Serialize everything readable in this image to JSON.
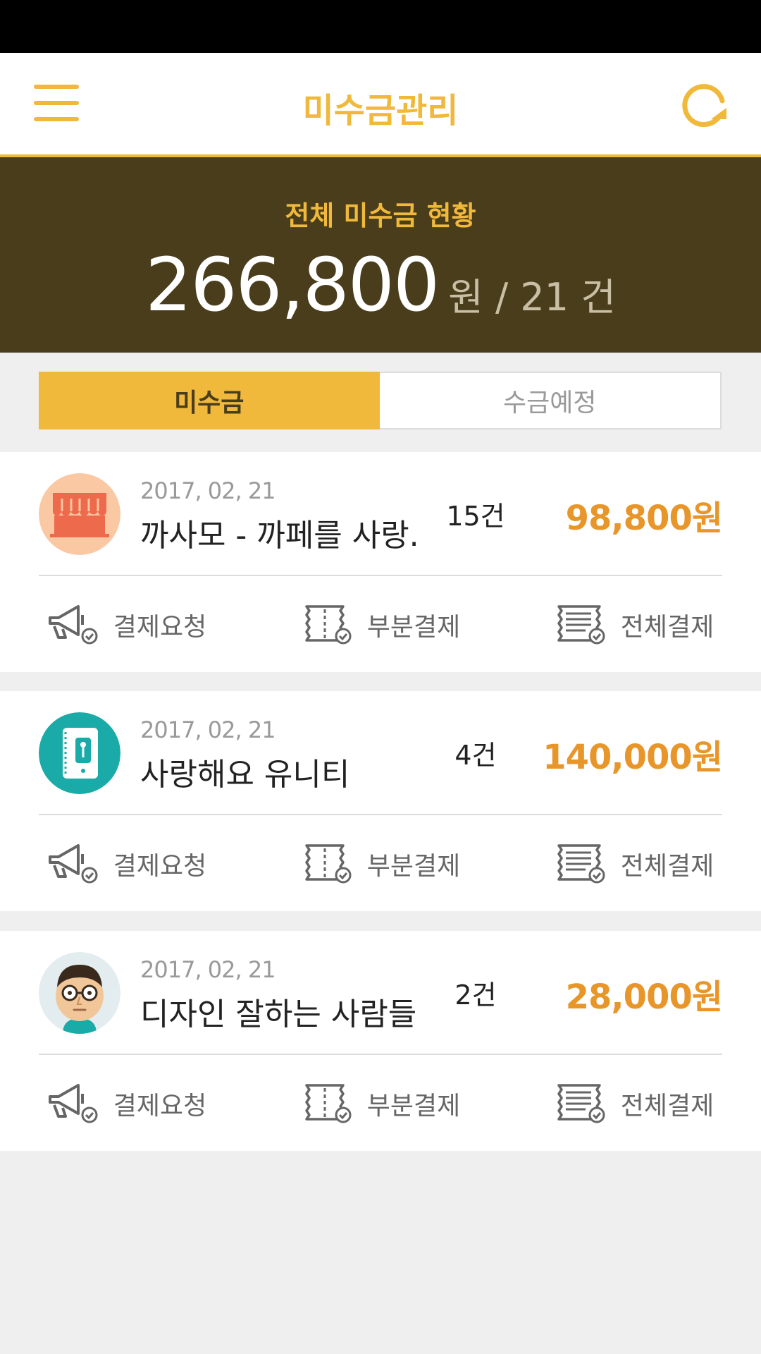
{
  "header": {
    "title": "미수금관리",
    "menu_icon": "hamburger-menu-icon",
    "refresh_icon": "refresh-icon",
    "accent": "#f0b93b"
  },
  "summary": {
    "label": "전체 미수금 현황",
    "amount": "266,800",
    "unit": "원 / 21 건",
    "bg": "#4a3d1c"
  },
  "tabs": [
    {
      "label": "미수금",
      "active": true
    },
    {
      "label": "수금예정",
      "active": false
    }
  ],
  "items": [
    {
      "avatar_icon": "store-awning-icon",
      "date": "2017, 02, 21",
      "name": "까사모 - 까페를 사랑...",
      "count": "15건",
      "amount": "98,800원"
    },
    {
      "avatar_icon": "zipper-notebook-icon",
      "date": "2017, 02, 21",
      "name": "사랑해요 유니티",
      "count": "4건",
      "amount": "140,000원"
    },
    {
      "avatar_icon": "glasses-man-avatar-icon",
      "date": "2017, 02, 21",
      "name": "디자인 잘하는 사람들",
      "count": "2건",
      "amount": "28,000원"
    }
  ],
  "actions": [
    {
      "label": "결제요청",
      "icon": "megaphone-check-icon"
    },
    {
      "label": "부분결제",
      "icon": "partial-receipt-check-icon"
    },
    {
      "label": "전체결제",
      "icon": "full-receipt-check-icon"
    }
  ]
}
